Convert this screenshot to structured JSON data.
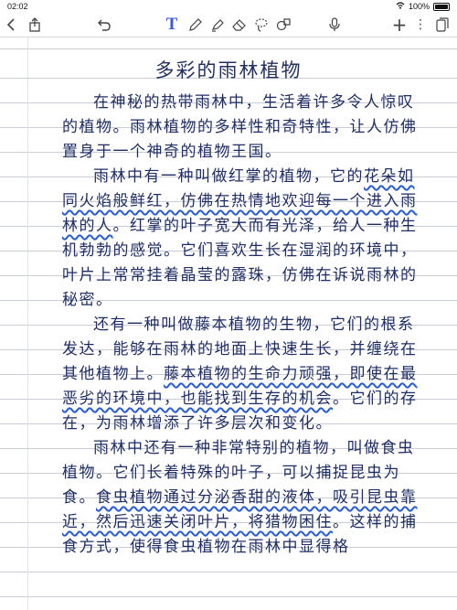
{
  "status": {
    "time": "02:02",
    "battery": "100%"
  },
  "toolbar": {
    "icons": [
      "back-chevron-icon",
      "share-icon",
      "undo-icon",
      "text-tool-icon",
      "pen-icon",
      "highlighter-icon",
      "eraser-icon",
      "lasso-icon",
      "shapes-icon",
      "microphone-icon",
      "add-icon",
      "more-icon",
      "pages-icon"
    ]
  },
  "document": {
    "title": "多彩的雨林植物",
    "p1": "在神秘的热带雨林中，生活着许多令人惊叹的植物。雨林植物的多样性和奇特性，让人仿佛置身于一个神奇的植物王国。",
    "p2a": "雨林中有一种叫做红掌的植物，它的",
    "p2u": "花朵如同火焰般鲜红，仿佛在热情地欢迎每一个进入雨林的人",
    "p2b": "。红掌的叶子宽大而有光泽，给人一种生机勃勃的感觉。它们喜欢生长在湿润的环境中，叶片上常常挂着晶莹的露珠，仿佛在诉说雨林的秘密。",
    "p3a": "还有一种叫做藤本植物的生物，它们的根系发达，能够在雨林的地面上快速生长，并缠绕在其他植物上。",
    "p3u": "藤本植物的生命力顽强，即使在最恶劣的环境中，也能找到生存的机会",
    "p3b": "。它们的存在，为雨林增添了许多层次和变化。",
    "p4a": "雨林中还有一种非常特别的植物，叫做食虫植物。它们长着特殊的叶子，可以捕捉昆虫为食。",
    "p4u": "食虫植物通过分泌香甜的液体，吸引昆虫靠近，然后迅速关闭叶片，将猎物困住",
    "p4b": "。这样的捕食方式，使得食虫植物在雨林中显得格"
  },
  "colors": {
    "ink": "#1f2d64",
    "underline": "#2a5bd7",
    "rule": "#c9ced6"
  }
}
